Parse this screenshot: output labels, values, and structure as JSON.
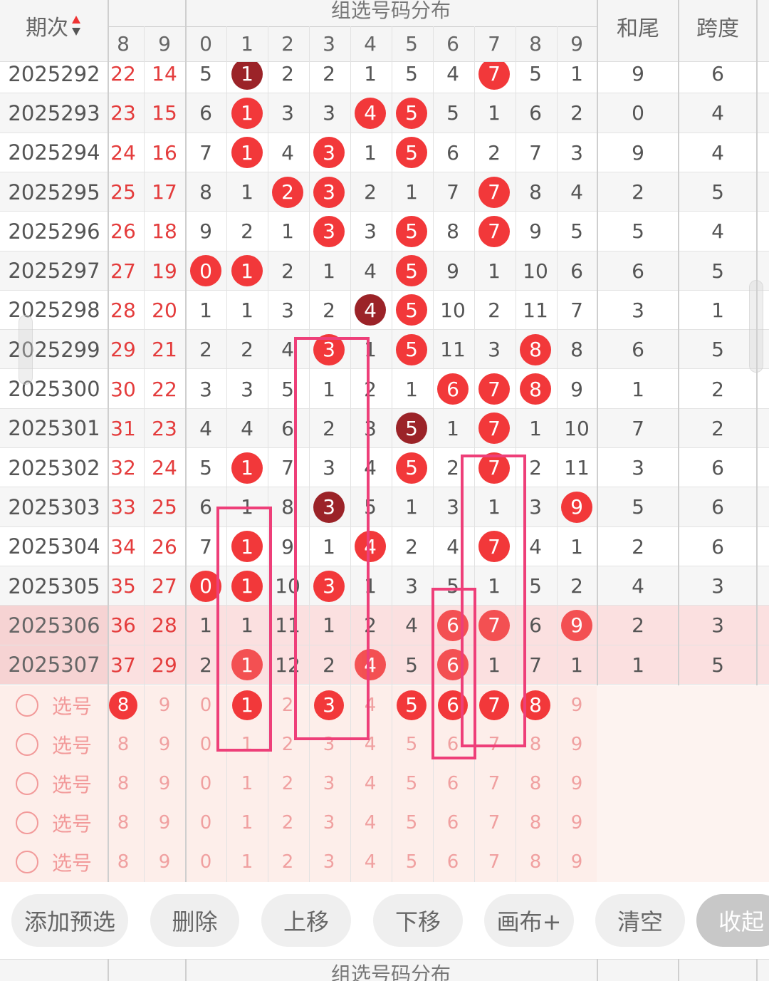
{
  "header": {
    "period_label": "期次",
    "sort_icon": "sort-up-down-icon",
    "group_title": "组选号码分布",
    "sum_tail_label": "和尾",
    "span_label": "跨度",
    "extra_digits": [
      "8",
      "9"
    ],
    "digits": [
      "0",
      "1",
      "2",
      "3",
      "4",
      "5",
      "6",
      "7",
      "8",
      "9"
    ]
  },
  "rows": [
    {
      "period": "2025292",
      "a": "22",
      "b": "14",
      "cells": [
        "5",
        "1",
        "2",
        "2",
        "1",
        "5",
        "4",
        "7",
        "5",
        "1"
      ],
      "sum_tail": "9",
      "span": "6"
    },
    {
      "period": "2025293",
      "a": "23",
      "b": "15",
      "cells": [
        "6",
        "1",
        "3",
        "3",
        "4",
        "5",
        "5",
        "1",
        "6",
        "2"
      ],
      "sum_tail": "0",
      "span": "4"
    },
    {
      "period": "2025294",
      "a": "24",
      "b": "16",
      "cells": [
        "7",
        "1",
        "4",
        "3",
        "1",
        "5",
        "6",
        "2",
        "7",
        "3"
      ],
      "sum_tail": "9",
      "span": "4"
    },
    {
      "period": "2025295",
      "a": "25",
      "b": "17",
      "cells": [
        "8",
        "1",
        "2",
        "3",
        "2",
        "1",
        "7",
        "7",
        "8",
        "4"
      ],
      "sum_tail": "2",
      "span": "5"
    },
    {
      "period": "2025296",
      "a": "26",
      "b": "18",
      "cells": [
        "9",
        "2",
        "1",
        "3",
        "3",
        "5",
        "8",
        "7",
        "9",
        "5"
      ],
      "sum_tail": "5",
      "span": "4"
    },
    {
      "period": "2025297",
      "a": "27",
      "b": "19",
      "cells": [
        "0",
        "1",
        "2",
        "1",
        "4",
        "5",
        "9",
        "1",
        "10",
        "6"
      ],
      "sum_tail": "6",
      "span": "5"
    },
    {
      "period": "2025298",
      "a": "28",
      "b": "20",
      "cells": [
        "1",
        "1",
        "3",
        "2",
        "4",
        "5",
        "10",
        "2",
        "11",
        "7"
      ],
      "sum_tail": "3",
      "span": "1"
    },
    {
      "period": "2025299",
      "a": "29",
      "b": "21",
      "cells": [
        "2",
        "2",
        "4",
        "3",
        "1",
        "5",
        "11",
        "3",
        "8",
        "8"
      ],
      "sum_tail": "6",
      "span": "5"
    },
    {
      "period": "2025300",
      "a": "30",
      "b": "22",
      "cells": [
        "3",
        "3",
        "5",
        "1",
        "2",
        "1",
        "6",
        "7",
        "8",
        "9"
      ],
      "sum_tail": "1",
      "span": "2"
    },
    {
      "period": "2025301",
      "a": "31",
      "b": "23",
      "cells": [
        "4",
        "4",
        "6",
        "2",
        "3",
        "5",
        "1",
        "7",
        "1",
        "10"
      ],
      "sum_tail": "7",
      "span": "2"
    },
    {
      "period": "2025302",
      "a": "32",
      "b": "24",
      "cells": [
        "5",
        "1",
        "7",
        "3",
        "4",
        "5",
        "2",
        "7",
        "2",
        "11"
      ],
      "sum_tail": "3",
      "span": "6"
    },
    {
      "period": "2025303",
      "a": "33",
      "b": "25",
      "cells": [
        "6",
        "1",
        "8",
        "3",
        "5",
        "1",
        "3",
        "1",
        "3",
        "9"
      ],
      "sum_tail": "5",
      "span": "6"
    },
    {
      "period": "2025304",
      "a": "34",
      "b": "26",
      "cells": [
        "7",
        "1",
        "9",
        "1",
        "4",
        "2",
        "4",
        "7",
        "4",
        "1"
      ],
      "sum_tail": "2",
      "span": "6"
    },
    {
      "period": "2025305",
      "a": "35",
      "b": "27",
      "cells": [
        "0",
        "1",
        "10",
        "3",
        "1",
        "3",
        "5",
        "1",
        "5",
        "2"
      ],
      "sum_tail": "4",
      "span": "3"
    },
    {
      "period": "2025306",
      "a": "36",
      "b": "28",
      "cells": [
        "1",
        "1",
        "11",
        "1",
        "2",
        "4",
        "6",
        "7",
        "6",
        "9"
      ],
      "sum_tail": "2",
      "span": "3"
    },
    {
      "period": "2025307",
      "a": "37",
      "b": "29",
      "cells": [
        "2",
        "1",
        "12",
        "2",
        "4",
        "5",
        "6",
        "1",
        "7",
        "1"
      ],
      "sum_tail": "1",
      "span": "5"
    }
  ],
  "select_rows": [
    {
      "label": "选号",
      "extra": [
        "8",
        "9"
      ],
      "digits": [
        "0",
        "1",
        "2",
        "3",
        "4",
        "5",
        "6",
        "7",
        "8",
        "9"
      ]
    },
    {
      "label": "选号",
      "extra": [
        "8",
        "9"
      ],
      "digits": [
        "0",
        "1",
        "2",
        "3",
        "4",
        "5",
        "6",
        "7",
        "8",
        "9"
      ]
    },
    {
      "label": "选号",
      "extra": [
        "8",
        "9"
      ],
      "digits": [
        "0",
        "1",
        "2",
        "3",
        "4",
        "5",
        "6",
        "7",
        "8",
        "9"
      ]
    },
    {
      "label": "选号",
      "extra": [
        "8",
        "9"
      ],
      "digits": [
        "0",
        "1",
        "2",
        "3",
        "4",
        "5",
        "6",
        "7",
        "8",
        "9"
      ]
    },
    {
      "label": "选号",
      "extra": [
        "8",
        "9"
      ],
      "digits": [
        "0",
        "1",
        "2",
        "3",
        "4",
        "5",
        "6",
        "7",
        "8",
        "9"
      ]
    }
  ],
  "buttons": {
    "add_preselect": "添加预选",
    "delete": "删除",
    "move_up": "上移",
    "move_down": "下移",
    "canvas_plus": "画布+",
    "clear": "清空",
    "collapse": "收起"
  },
  "footer": {
    "group_title": "组选号码分布"
  },
  "colors": {
    "ball_red": "#f2383a",
    "ball_dark": "#9b2328",
    "mark_pink": "#ee3f79",
    "period_red": "#e43c3c",
    "highlight_row": "#fbe0e0",
    "select_bg": "#fdeeea"
  }
}
